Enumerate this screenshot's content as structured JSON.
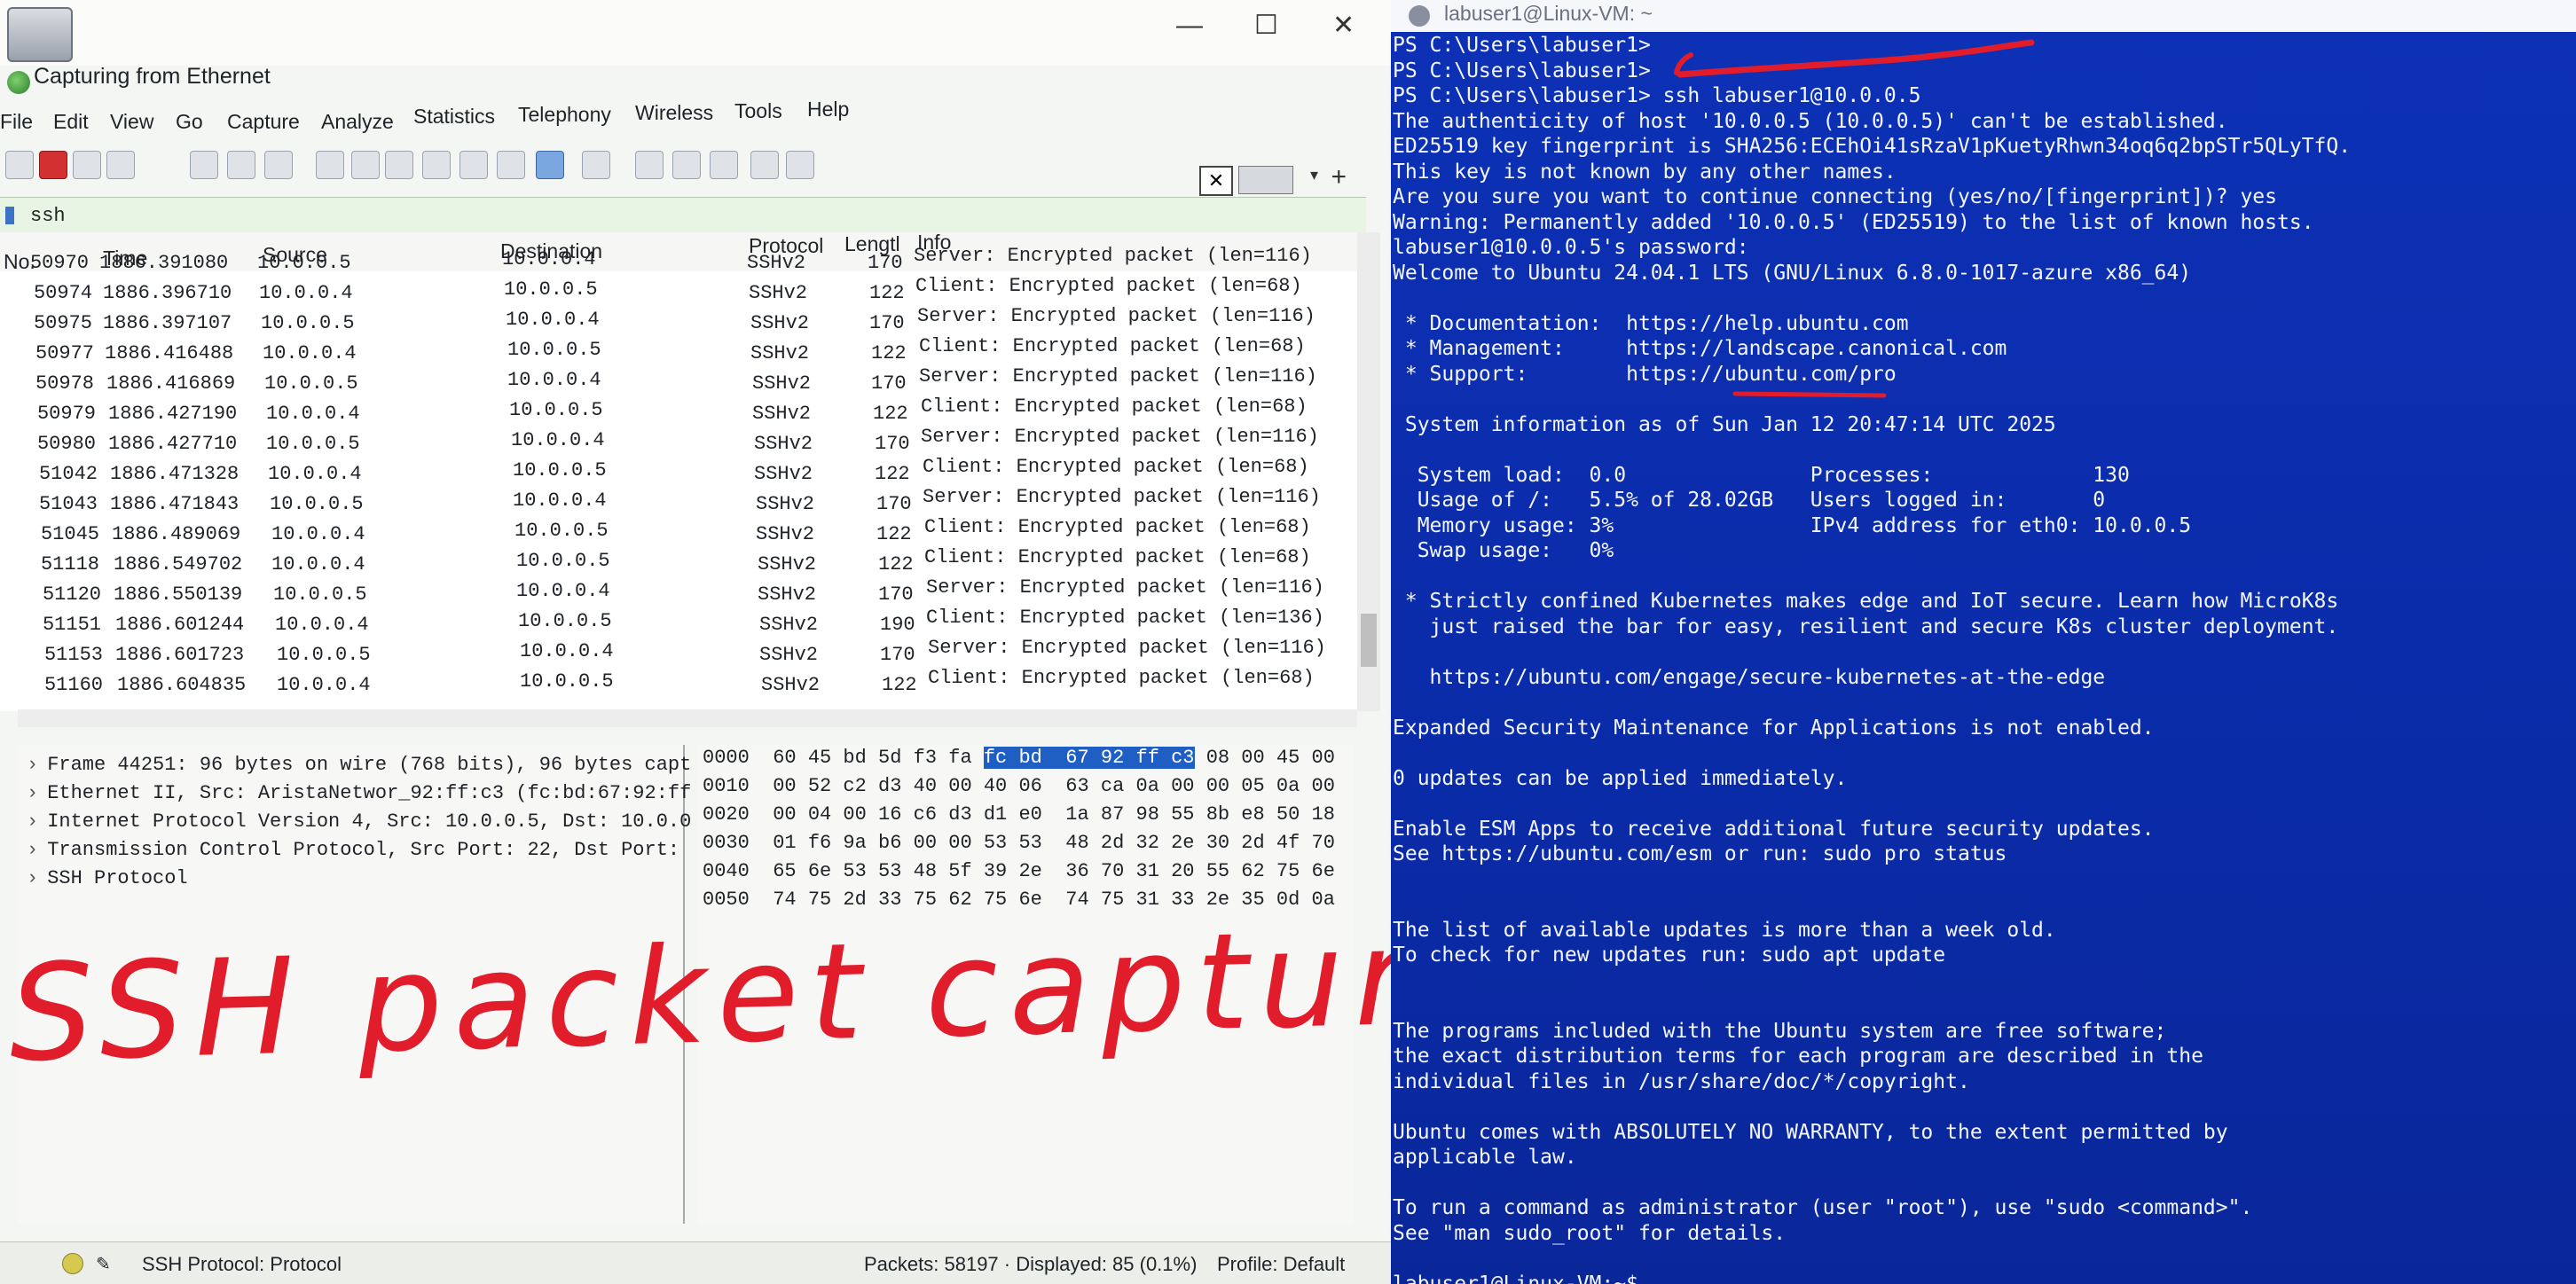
{
  "wireshark": {
    "title": "Capturing from Ethernet",
    "menu": [
      "File",
      "Edit",
      "View",
      "Go",
      "Capture",
      "Analyze",
      "Statistics",
      "Telephony",
      "Wireless",
      "Tools",
      "Help"
    ],
    "filter": "ssh",
    "columns": {
      "no": "No.",
      "time": "Time",
      "source": "Source",
      "destination": "Destination",
      "protocol": "Protocol",
      "length": "Lengtl",
      "info": "Info"
    },
    "packets": [
      {
        "no": "50970",
        "time": "1886.391080",
        "src": "10.0.0.5",
        "dst": "10.0.0.4",
        "proto": "SSHv2",
        "len": "170",
        "info": "Server: Encrypted packet (len=116)"
      },
      {
        "no": "50974",
        "time": "1886.396710",
        "src": "10.0.0.4",
        "dst": "10.0.0.5",
        "proto": "SSHv2",
        "len": "122",
        "info": "Client: Encrypted packet (len=68)"
      },
      {
        "no": "50975",
        "time": "1886.397107",
        "src": "10.0.0.5",
        "dst": "10.0.0.4",
        "proto": "SSHv2",
        "len": "170",
        "info": "Server: Encrypted packet (len=116)"
      },
      {
        "no": "50977",
        "time": "1886.416488",
        "src": "10.0.0.4",
        "dst": "10.0.0.5",
        "proto": "SSHv2",
        "len": "122",
        "info": "Client: Encrypted packet (len=68)"
      },
      {
        "no": "50978",
        "time": "1886.416869",
        "src": "10.0.0.5",
        "dst": "10.0.0.4",
        "proto": "SSHv2",
        "len": "170",
        "info": "Server: Encrypted packet (len=116)"
      },
      {
        "no": "50979",
        "time": "1886.427190",
        "src": "10.0.0.4",
        "dst": "10.0.0.5",
        "proto": "SSHv2",
        "len": "122",
        "info": "Client: Encrypted packet (len=68)"
      },
      {
        "no": "50980",
        "time": "1886.427710",
        "src": "10.0.0.5",
        "dst": "10.0.0.4",
        "proto": "SSHv2",
        "len": "170",
        "info": "Server: Encrypted packet (len=116)"
      },
      {
        "no": "51042",
        "time": "1886.471328",
        "src": "10.0.0.4",
        "dst": "10.0.0.5",
        "proto": "SSHv2",
        "len": "122",
        "info": "Client: Encrypted packet (len=68)"
      },
      {
        "no": "51043",
        "time": "1886.471843",
        "src": "10.0.0.5",
        "dst": "10.0.0.4",
        "proto": "SSHv2",
        "len": "170",
        "info": "Server: Encrypted packet (len=116)"
      },
      {
        "no": "51045",
        "time": "1886.489069",
        "src": "10.0.0.4",
        "dst": "10.0.0.5",
        "proto": "SSHv2",
        "len": "122",
        "info": "Client: Encrypted packet (len=68)"
      },
      {
        "no": "51118",
        "time": "1886.549702",
        "src": "10.0.0.4",
        "dst": "10.0.0.5",
        "proto": "SSHv2",
        "len": "122",
        "info": "Client: Encrypted packet (len=68)"
      },
      {
        "no": "51120",
        "time": "1886.550139",
        "src": "10.0.0.5",
        "dst": "10.0.0.4",
        "proto": "SSHv2",
        "len": "170",
        "info": "Server: Encrypted packet (len=116)"
      },
      {
        "no": "51151",
        "time": "1886.601244",
        "src": "10.0.0.4",
        "dst": "10.0.0.5",
        "proto": "SSHv2",
        "len": "190",
        "info": "Client: Encrypted packet (len=136)"
      },
      {
        "no": "51153",
        "time": "1886.601723",
        "src": "10.0.0.5",
        "dst": "10.0.0.4",
        "proto": "SSHv2",
        "len": "170",
        "info": "Server: Encrypted packet (len=116)"
      },
      {
        "no": "51160",
        "time": "1886.604835",
        "src": "10.0.0.4",
        "dst": "10.0.0.5",
        "proto": "SSHv2",
        "len": "122",
        "info": "Client: Encrypted packet (len=68)"
      }
    ],
    "details": [
      "Frame 44251: 96 bytes on wire (768 bits), 96 bytes capt",
      "Ethernet II, Src: AristaNetwor_92:ff:c3 (fc:bd:67:92:ff",
      "Internet Protocol Version 4, Src: 10.0.0.5, Dst: 10.0.0",
      "Transmission Control Protocol, Src Port: 22, Dst Port:",
      "SSH Protocol"
    ],
    "bytes": [
      {
        "off": "0000",
        "pre": "60 45 bd 5d f3 fa ",
        "hl": "fc bd  67 92 ff c3",
        "post": " 08 00 45 00"
      },
      {
        "off": "0010",
        "pre": "00 52 c2 d3 40 00 40 06  63 ca 0a 00 00 05 0a 00",
        "hl": "",
        "post": ""
      },
      {
        "off": "0020",
        "pre": "00 04 00 16 c6 d3 d1 e0  1a 87 98 55 8b e8 50 18",
        "hl": "",
        "post": ""
      },
      {
        "off": "0030",
        "pre": "01 f6 9a b6 00 00 53 53  48 2d 32 2e 30 2d 4f 70",
        "hl": "",
        "post": ""
      },
      {
        "off": "0040",
        "pre": "65 6e 53 53 48 5f 39 2e  36 70 31 20 55 62 75 6e",
        "hl": "",
        "post": ""
      },
      {
        "off": "0050",
        "pre": "74 75 2d 33 75 62 75 6e  74 75 31 33 2e 35 0d 0a",
        "hl": "",
        "post": ""
      }
    ],
    "annotation": "SSH packet capture",
    "status": {
      "field": "SSH Protocol: Protocol",
      "packets": "Packets: 58197 · Displayed: 85 (0.1%)",
      "profile": "Profile: Default"
    }
  },
  "terminal": {
    "title": "labuser1@Linux-VM: ~",
    "lines": [
      "PS C:\\Users\\labuser1>",
      "PS C:\\Users\\labuser1>",
      "PS C:\\Users\\labuser1> ssh labuser1@10.0.0.5",
      "The authenticity of host '10.0.0.5 (10.0.0.5)' can't be established.",
      "ED25519 key fingerprint is SHA256:ECEhOi41sRzaV1pKuetyRhwn34oq6q2bpSTr5QLyTfQ.",
      "This key is not known by any other names.",
      "Are you sure you want to continue connecting (yes/no/[fingerprint])? yes",
      "Warning: Permanently added '10.0.0.5' (ED25519) to the list of known hosts.",
      "labuser1@10.0.0.5's password:",
      "Welcome to Ubuntu 24.04.1 LTS (GNU/Linux 6.8.0-1017-azure x86_64)",
      "",
      " * Documentation:  https://help.ubuntu.com",
      " * Management:     https://landscape.canonical.com",
      " * Support:        https://ubuntu.com/pro",
      "",
      " System information as of Sun Jan 12 20:47:14 UTC 2025",
      "",
      "  System load:  0.0               Processes:             130",
      "  Usage of /:   5.5% of 28.02GB   Users logged in:       0",
      "  Memory usage: 3%                IPv4 address for eth0: 10.0.0.5",
      "  Swap usage:   0%",
      "",
      " * Strictly confined Kubernetes makes edge and IoT secure. Learn how MicroK8s",
      "   just raised the bar for easy, resilient and secure K8s cluster deployment.",
      "",
      "   https://ubuntu.com/engage/secure-kubernetes-at-the-edge",
      "",
      "Expanded Security Maintenance for Applications is not enabled.",
      "",
      "0 updates can be applied immediately.",
      "",
      "Enable ESM Apps to receive additional future security updates.",
      "See https://ubuntu.com/esm or run: sudo pro status",
      "",
      "",
      "The list of available updates is more than a week old.",
      "To check for new updates run: sudo apt update",
      "",
      "",
      "The programs included with the Ubuntu system are free software;",
      "the exact distribution terms for each program are described in the",
      "individual files in /usr/share/doc/*/copyright.",
      "",
      "Ubuntu comes with ABSOLUTELY NO WARRANTY, to the extent permitted by",
      "applicable law.",
      "",
      "To run a command as administrator (user \"root\"), use \"sudo <command>\".",
      "See \"man sudo_root\" for details.",
      "",
      "labuser1@Linux-VM:~$"
    ]
  }
}
